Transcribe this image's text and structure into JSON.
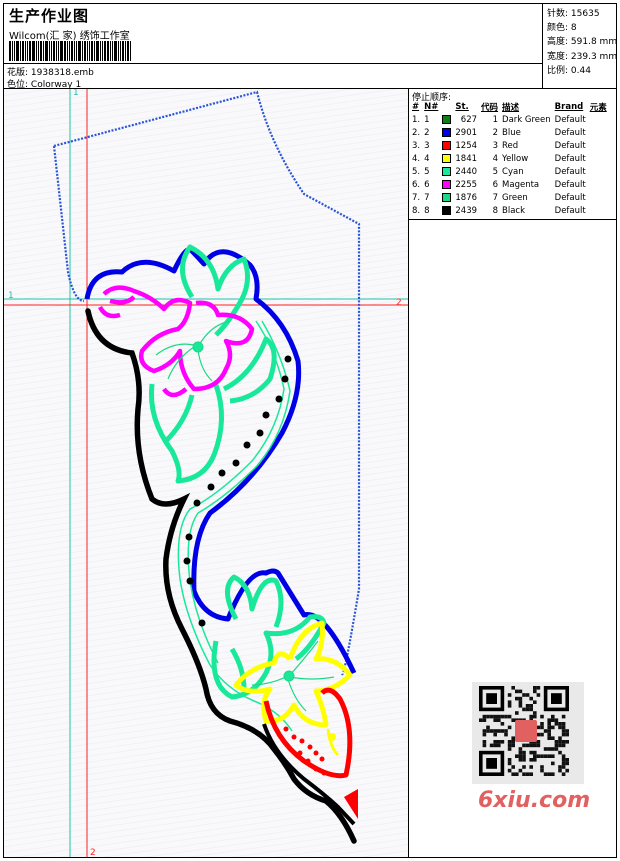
{
  "header": {
    "title": "生产作业图",
    "company": "Wilcom(汇 家) 绣饰工作室",
    "design_label": "花版:",
    "design_file": "1938318.emb",
    "colorway_label": "色位:",
    "colorway": "Colorway 1"
  },
  "stats": {
    "stitches_label": "针数:",
    "stitches": "15635",
    "colors_label": "颜色:",
    "colors": "8",
    "height_label": "高度:",
    "height": "591.8 mm",
    "width_label": "宽度:",
    "width": "239.3 mm",
    "scale_label": "比例:",
    "scale": "0.44"
  },
  "stop_sequence": {
    "title": "停止顺序:",
    "headers": [
      "#",
      "N#",
      "St.",
      "代码",
      "描述",
      "Brand",
      "元素"
    ],
    "rows": [
      {
        "index": "1.",
        "n": "1",
        "color": "#107e16",
        "stitches": "627",
        "code": "1",
        "desc": "Dark Green",
        "brand": "Default"
      },
      {
        "index": "2.",
        "n": "2",
        "color": "#0000e6",
        "stitches": "2901",
        "code": "2",
        "desc": "Blue",
        "brand": "Default"
      },
      {
        "index": "3.",
        "n": "3",
        "color": "#ff0000",
        "stitches": "1254",
        "code": "3",
        "desc": "Red",
        "brand": "Default"
      },
      {
        "index": "4.",
        "n": "4",
        "color": "#ffff00",
        "stitches": "1841",
        "code": "4",
        "desc": "Yellow",
        "brand": "Default"
      },
      {
        "index": "5.",
        "n": "5",
        "color": "#19e89a",
        "stitches": "2440",
        "code": "5",
        "desc": "Cyan",
        "brand": "Default"
      },
      {
        "index": "6.",
        "n": "6",
        "color": "#ff00ff",
        "stitches": "2255",
        "code": "6",
        "desc": "Magenta",
        "brand": "Default"
      },
      {
        "index": "7.",
        "n": "7",
        "color": "#1bd884",
        "stitches": "1876",
        "code": "7",
        "desc": "Green",
        "brand": "Default"
      },
      {
        "index": "8.",
        "n": "8",
        "color": "#000000",
        "stitches": "2439",
        "code": "8",
        "desc": "Black",
        "brand": "Default"
      }
    ]
  },
  "canvas": {
    "marker_1": "1",
    "marker_2": "2",
    "colors": {
      "guide_cyan": "#1fc3a6",
      "guide_red": "#ff2020",
      "outline_blue": "#2a55d8"
    }
  },
  "watermark": {
    "site": "6xiu.com"
  }
}
